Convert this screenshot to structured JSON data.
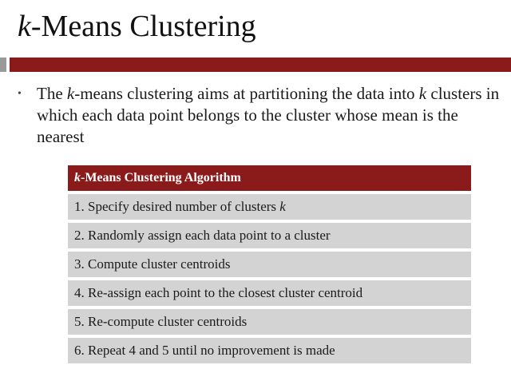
{
  "slide": {
    "title_italic": "k",
    "title_rest": "-Means Clustering",
    "bullet": {
      "t1": "The ",
      "t2": "k",
      "t3": "-means clustering aims at partitioning the data into ",
      "t4": "k",
      "t5": " clusters in which each data point belongs to the cluster whose mean is the nearest"
    },
    "table": {
      "header_italic": "k",
      "header_rest": "-Means Clustering Algorithm",
      "rows": [
        {
          "text": "1.  Specify desired number of clusters ",
          "italic": "k"
        },
        {
          "text": "2.  Randomly assign each data point to a cluster",
          "italic": ""
        },
        {
          "text": "3.  Compute cluster centroids",
          "italic": ""
        },
        {
          "text": "4.  Re-assign each point to the closest cluster centroid",
          "italic": ""
        },
        {
          "text": "5.  Re-compute cluster centroids",
          "italic": ""
        },
        {
          "text": "6.  Repeat 4 and 5 until no improvement is made",
          "italic": ""
        }
      ]
    },
    "colors": {
      "accent": "#8b1a1a",
      "row_bg": "#d3d3d3",
      "side_gray": "#9a9a9a"
    }
  }
}
